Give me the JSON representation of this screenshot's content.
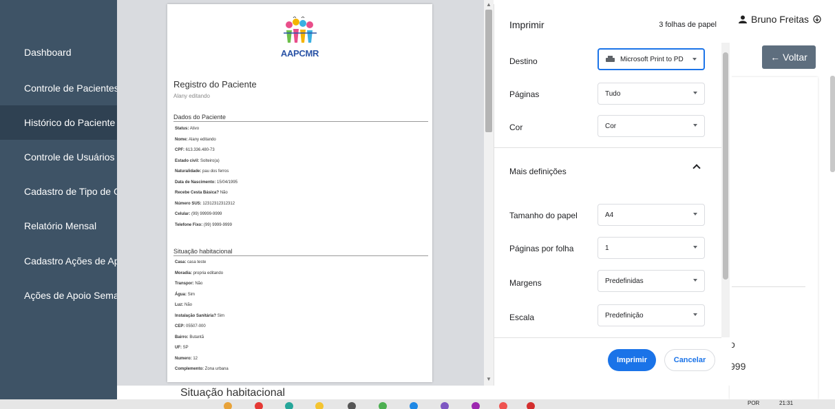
{
  "app": {
    "sidebar": [
      {
        "label": "Dashboard"
      },
      {
        "label": "Controle de Pacientes"
      },
      {
        "label": "Histórico do Paciente"
      },
      {
        "label": "Controle de Usuários"
      },
      {
        "label": "Cadastro de Tipo de Ga"
      },
      {
        "label": "Relatório Mensal"
      },
      {
        "label": "Cadastro Ações de Apo"
      },
      {
        "label": "Ações de Apoio Seman"
      }
    ],
    "user_name": "Bruno Freitas",
    "back_button": "← Voltar",
    "partial_text_1": "o",
    "partial_text_2": "999",
    "bottom_section": "Situação habitacional"
  },
  "preview": {
    "logo_text": "AAPCMR",
    "title": "Registro do Paciente",
    "subtitle": "Alany editando",
    "section1": "Dados do Paciente",
    "fields1": [
      {
        "label": "Status:",
        "value": "Ativo"
      },
      {
        "label": "Nome:",
        "value": "Alany editando"
      },
      {
        "label": "CPF:",
        "value": "613.336.480-73"
      },
      {
        "label": "Estado civil:",
        "value": "Solteiro(a)"
      },
      {
        "label": "Naturalidade:",
        "value": "pau dos ferros"
      },
      {
        "label": "Data de Nascimento:",
        "value": "15/04/1995"
      },
      {
        "label": "Recebe Cesta Básica?",
        "value": "Não"
      },
      {
        "label": "Número SUS:",
        "value": "12312312312312"
      },
      {
        "label": "Celular:",
        "value": "(99) 99999-9999"
      },
      {
        "label": "Telefone Fixo:",
        "value": "(99) 9999-9999"
      }
    ],
    "section2": "Situação habitacional",
    "fields2": [
      {
        "label": "Casa:",
        "value": "casa teste"
      },
      {
        "label": "Moradia:",
        "value": "propria editando"
      },
      {
        "label": "Transpor:",
        "value": "Não"
      },
      {
        "label": "Água:",
        "value": "Sim"
      },
      {
        "label": "Luz:",
        "value": "Não"
      },
      {
        "label": "Instalação Sanitária?",
        "value": "Sim"
      },
      {
        "label": "CEP:",
        "value": "05507-000"
      },
      {
        "label": "Bairro:",
        "value": "Butantã"
      },
      {
        "label": "UF:",
        "value": "SP"
      },
      {
        "label": "Numero:",
        "value": "12"
      },
      {
        "label": "Complemento:",
        "value": "Zona urbana"
      }
    ]
  },
  "print_dialog": {
    "title": "Imprimir",
    "sheets": "3 folhas de papel",
    "destination_label": "Destino",
    "destination_value": "Microsoft Print to PD",
    "pages_label": "Páginas",
    "pages_value": "Tudo",
    "color_label": "Cor",
    "color_value": "Cor",
    "more_settings": "Mais definições",
    "paper_size_label": "Tamanho do papel",
    "paper_size_value": "A4",
    "pages_per_sheet_label": "Páginas por folha",
    "pages_per_sheet_value": "1",
    "margins_label": "Margens",
    "margins_value": "Predefinidas",
    "scale_label": "Escala",
    "scale_value": "Predefinição",
    "print_button": "Imprimir",
    "cancel_button": "Cancelar"
  },
  "taskbar": {
    "lang": "POR",
    "time": "21:31"
  },
  "colors": {
    "sidebar": "#3e5366",
    "primary": "#1a73e8",
    "logo": "#2a53a6"
  }
}
